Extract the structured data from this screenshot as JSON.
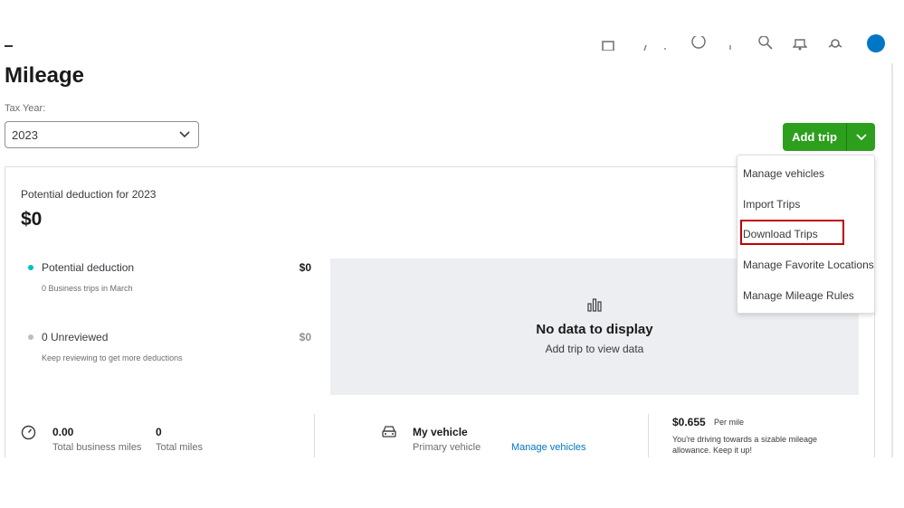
{
  "page": {
    "title": "Mileage",
    "tax_year_label": "Tax Year:",
    "tax_year_value": "2023"
  },
  "actions": {
    "add_trip_label": "Add trip"
  },
  "dropdown": {
    "items": [
      {
        "label": "Manage vehicles"
      },
      {
        "label": "Import Trips"
      },
      {
        "label": "Download Trips"
      },
      {
        "label": "Manage Favorite Locations"
      },
      {
        "label": "Manage Mileage Rules"
      }
    ]
  },
  "summary": {
    "title": "Potential deduction for 2023",
    "value": "$0",
    "rows": [
      {
        "label": "Potential deduction",
        "sub": "0 Business trips in March",
        "amount": "$0",
        "dot_color": "#00c1bf"
      },
      {
        "label": "0 Unreviewed",
        "sub": "Keep reviewing to get more deductions",
        "amount": "$0",
        "dot_color": "#babec5"
      }
    ]
  },
  "empty_state": {
    "title": "No data to display",
    "subtitle": "Add trip to view data"
  },
  "stats": {
    "business_miles_value": "0.00",
    "business_miles_label": "Total business miles",
    "total_miles_value": "0",
    "total_miles_label": "Total miles",
    "vehicle_name": "My vehicle",
    "vehicle_sub": "Primary vehicle",
    "manage_vehicles_link": "Manage vehicles",
    "rate_value": "$0.655",
    "rate_unit": "Per mile",
    "rate_note_1": "You're driving towards a sizable mileage",
    "rate_note_2": "allowance. Keep it up!"
  },
  "colors": {
    "accent_green": "#2ca01c",
    "link_blue": "#0077c5",
    "highlight_red": "#c00000"
  },
  "icons": {
    "chart": "bar-chart-icon",
    "speedometer": "speedometer-icon",
    "car": "car-icon"
  }
}
